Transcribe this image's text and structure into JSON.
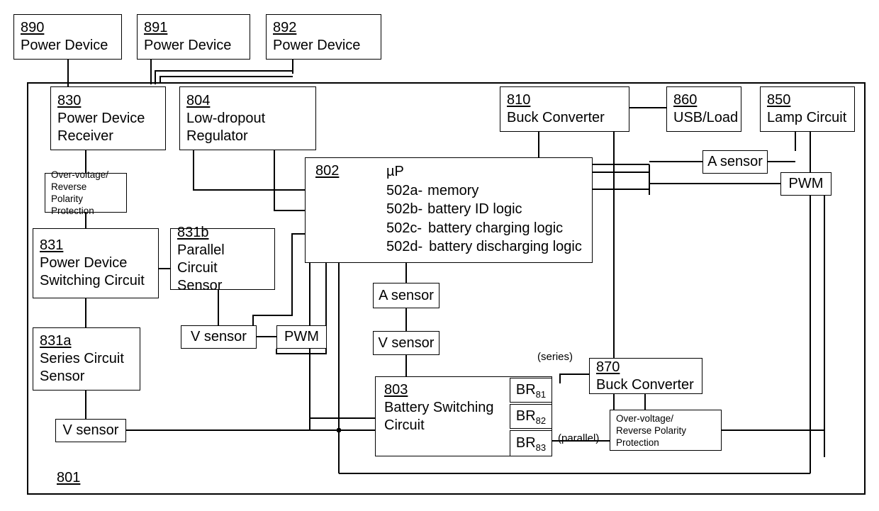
{
  "diagram": {
    "outer_frame_label": "801",
    "power_devices": [
      {
        "num": "890",
        "label": "Power Device"
      },
      {
        "num": "891",
        "label": "Power Device"
      },
      {
        "num": "892",
        "label": "Power Device"
      }
    ],
    "blocks": {
      "receiver": {
        "num": "830",
        "line1": "Power Device",
        "line2": "Receiver"
      },
      "ldo": {
        "num": "804",
        "line1": "Low-dropout",
        "line2": "Regulator"
      },
      "buck810": {
        "num": "810",
        "label": "Buck Converter"
      },
      "usb860": {
        "num": "860",
        "label": "USB/Load"
      },
      "lamp850": {
        "num": "850",
        "label": "Lamp Circuit"
      },
      "switch831": {
        "num": "831",
        "line1": "Power Device",
        "line2": "Switching Circuit"
      },
      "parallel831b": {
        "num": "831b",
        "line1": "Parallel Circuit",
        "line2": "Sensor"
      },
      "series831a": {
        "num": "831a",
        "line1": "Series Circuit",
        "line2": "Sensor"
      },
      "battery803": {
        "num": "803",
        "line1": "Battery Switching",
        "line2": "Circuit"
      },
      "buck870": {
        "num": "870",
        "label": "Buck Converter"
      }
    },
    "micro": {
      "num": "802",
      "title": "µP",
      "lines": [
        {
          "ref": "502a-",
          "text": "memory"
        },
        {
          "ref": "502b-",
          "text": "battery ID logic"
        },
        {
          "ref": "502c-",
          "text": "battery charging logic"
        },
        {
          "ref": "502d-",
          "text": "battery discharging logic"
        }
      ]
    },
    "protection": {
      "line1": "Over-voltage/",
      "line2": "Reverse Polarity",
      "line3": "Protection"
    },
    "battery_rails": [
      {
        "base": "BR",
        "sub": "81"
      },
      {
        "base": "BR",
        "sub": "82"
      },
      {
        "base": "BR",
        "sub": "83"
      }
    ],
    "sensors": {
      "a_sensor": "A sensor",
      "v_sensor": "V sensor",
      "pwm": "PWM"
    },
    "annotations": {
      "series": "(series)",
      "parallel": "(parallel)"
    },
    "colors": {
      "line": "#000000",
      "background": "#ffffff"
    }
  }
}
